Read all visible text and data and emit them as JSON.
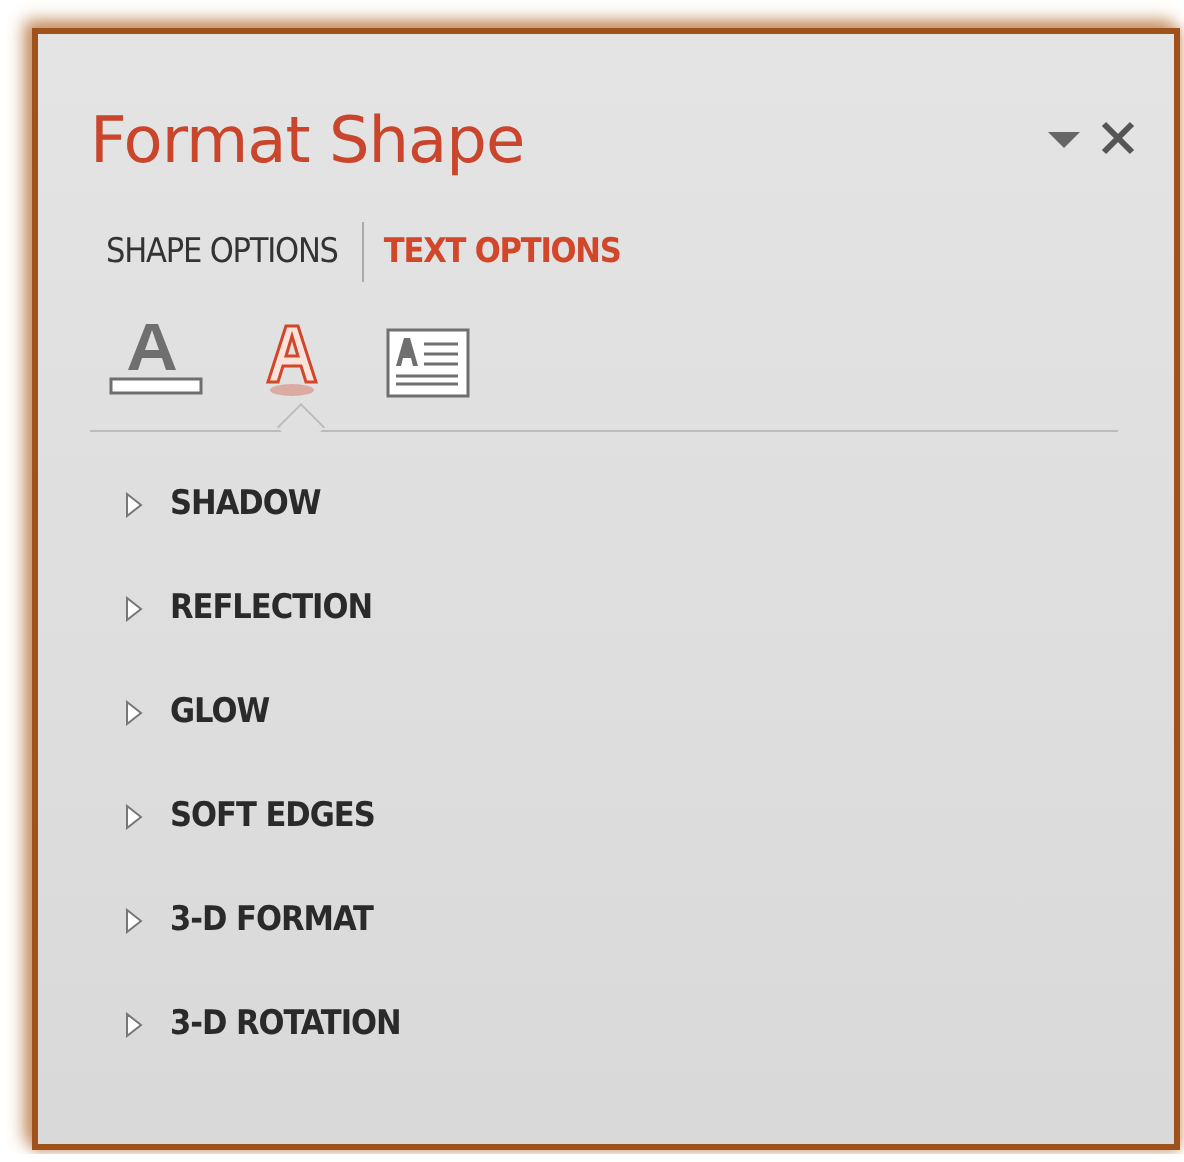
{
  "window": {
    "title": "Format Shape"
  },
  "tabs": [
    {
      "label": "SHAPE OPTIONS",
      "selected": false
    },
    {
      "label": "TEXT OPTIONS",
      "selected": true
    }
  ],
  "icon_tabs": [
    {
      "kind": "fill",
      "selected": false
    },
    {
      "kind": "effects",
      "selected": true
    },
    {
      "kind": "textbox",
      "selected": false
    }
  ],
  "sections": [
    {
      "label": "SHADOW",
      "expanded": false
    },
    {
      "label": "REFLECTION",
      "expanded": false
    },
    {
      "label": "GLOW",
      "expanded": false
    },
    {
      "label": "SOFT EDGES",
      "expanded": false
    },
    {
      "label": "3-D FORMAT",
      "expanded": false
    },
    {
      "label": "3-D ROTATION",
      "expanded": false
    }
  ]
}
